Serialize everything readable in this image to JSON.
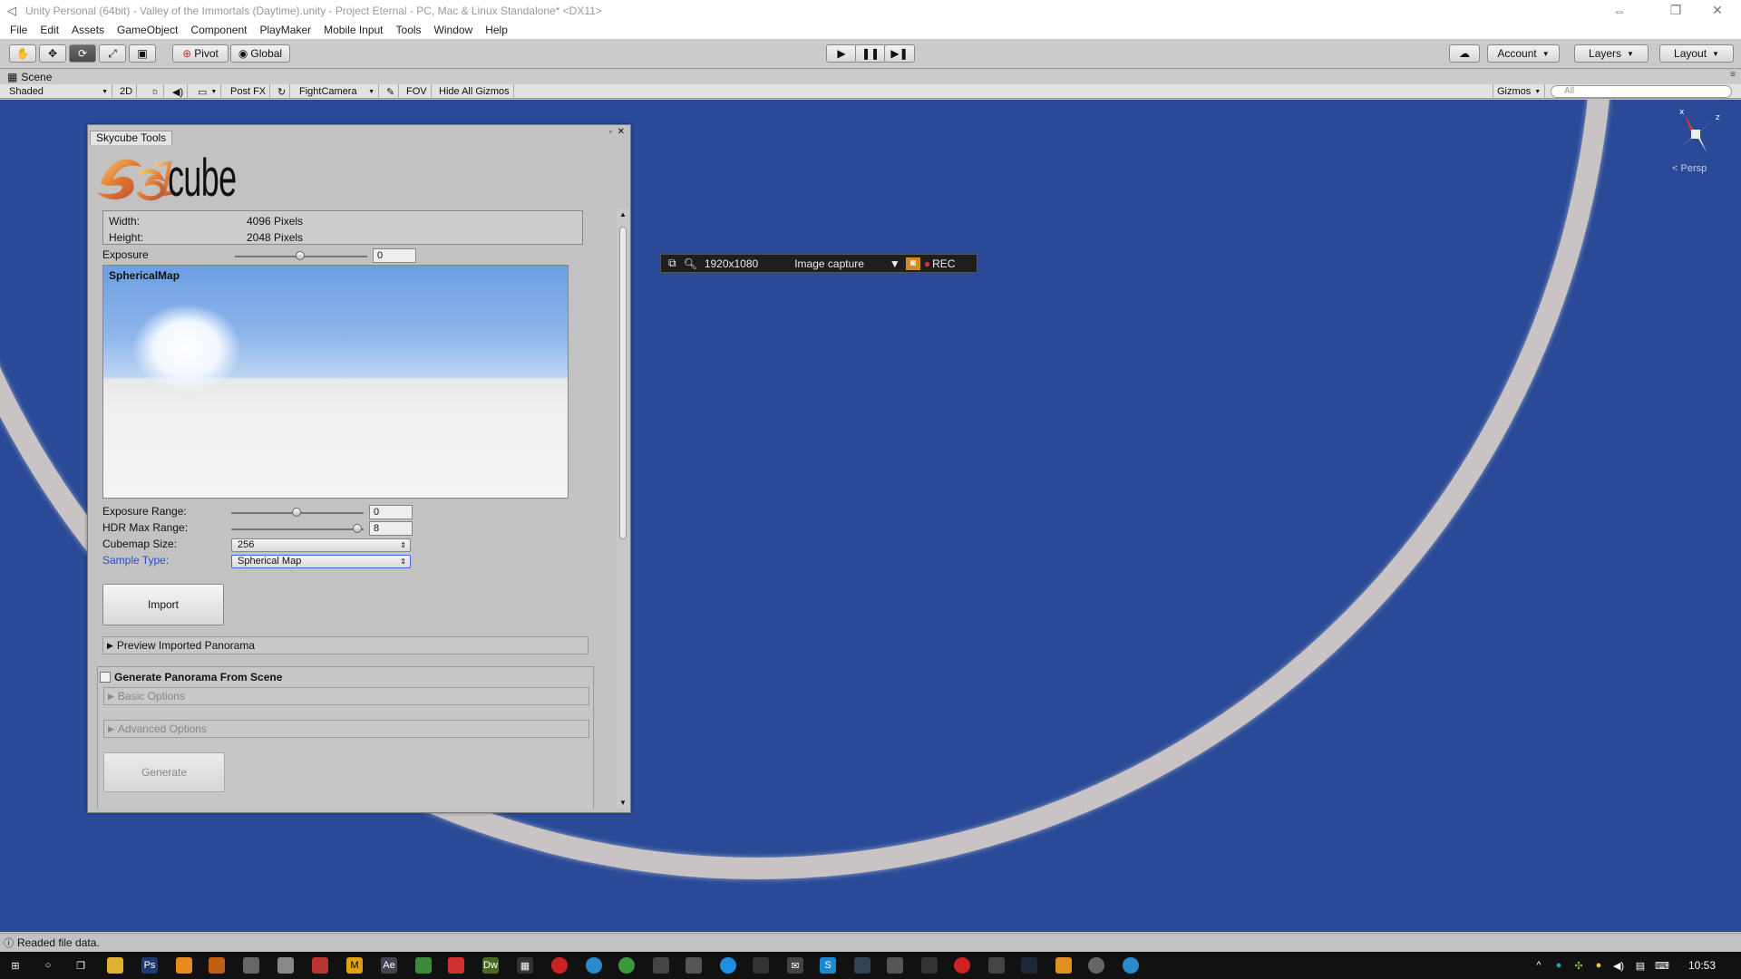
{
  "window": {
    "title": "Unity Personal (64bit) - Valley of the Immortals (Daytime).unity - Project Eternal - PC, Mac & Linux Standalone* <DX11>"
  },
  "menu": [
    "File",
    "Edit",
    "Assets",
    "GameObject",
    "Component",
    "PlayMaker",
    "Mobile Input",
    "Tools",
    "Window",
    "Help"
  ],
  "toolbar": {
    "pivot": "Pivot",
    "global": "Global",
    "account": "Account",
    "layers": "Layers",
    "layout": "Layout"
  },
  "scene_tab": {
    "label": "Scene"
  },
  "scene_toolbar": {
    "shading": "Shaded",
    "mode2d": "2D",
    "postfx": "Post FX",
    "camera": "FightCamera",
    "fov": "FOV",
    "hide_gizmos": "Hide All Gizmos",
    "gizmos": "Gizmos",
    "search_placeholder": "All"
  },
  "gizmo": {
    "label": "Persp",
    "x": "x",
    "z": "z"
  },
  "capture": {
    "resolution": "1920x1080",
    "mode": "Image capture",
    "rec": "REC"
  },
  "skycube": {
    "tab": "Skycube Tools",
    "logo_text": "cube",
    "width_label": "Width:",
    "width_value": "4096 Pixels",
    "height_label": "Height:",
    "height_value": "2048 Pixels",
    "exposure_label": "Exposure",
    "exposure_value": "0",
    "preview_label": "SphericalMap",
    "exposure_range_label": "Exposure Range:",
    "exposure_range_value": "0",
    "hdr_max_label": "HDR Max Range:",
    "hdr_max_value": "8",
    "cubemap_size_label": "Cubemap Size:",
    "cubemap_size_value": "256",
    "sample_type_label": "Sample Type:",
    "sample_type_value": "Spherical Map",
    "import_label": "Import",
    "preview_imported_label": "Preview Imported Panorama",
    "generate_section_label": "Generate Panorama From Scene",
    "basic_options_label": "Basic Options",
    "advanced_options_label": "Advanced Options",
    "generate_label": "Generate"
  },
  "status": {
    "message": "Readed file data."
  },
  "taskbar": {
    "time": "10:53"
  }
}
